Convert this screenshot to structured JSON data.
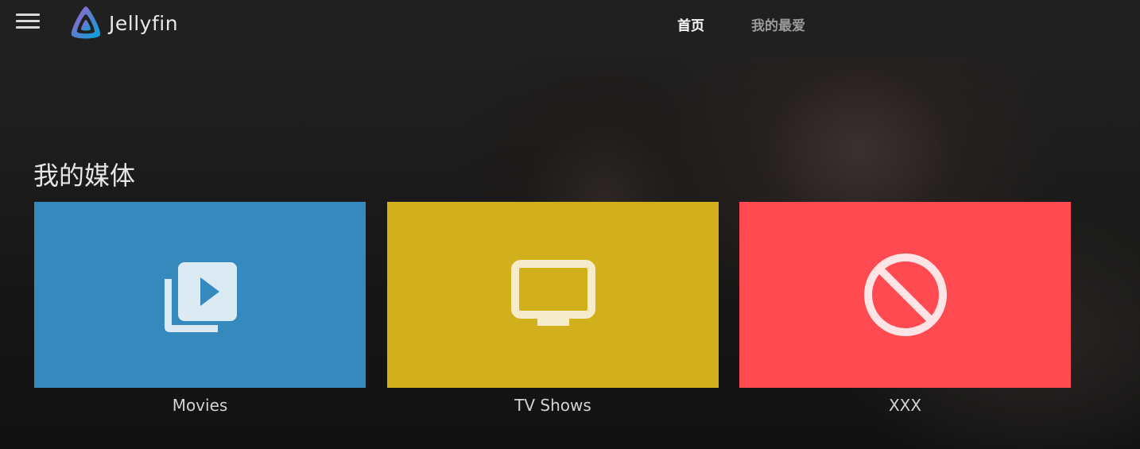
{
  "header": {
    "app_name": "Jellyfin",
    "tabs": [
      {
        "label": "首页",
        "active": true
      },
      {
        "label": "我的最爱",
        "active": false
      }
    ]
  },
  "main": {
    "section_title": "我的媒体",
    "libraries": [
      {
        "label": "Movies",
        "color": "#3689bd",
        "icon": "video-library-icon"
      },
      {
        "label": "TV Shows",
        "color": "#d2b01c",
        "icon": "tv-icon"
      },
      {
        "label": "XXX",
        "color": "#ff4a51",
        "icon": "block-icon"
      }
    ]
  },
  "colors": {
    "header_bg": "#202020",
    "page_bg": "#101010"
  }
}
